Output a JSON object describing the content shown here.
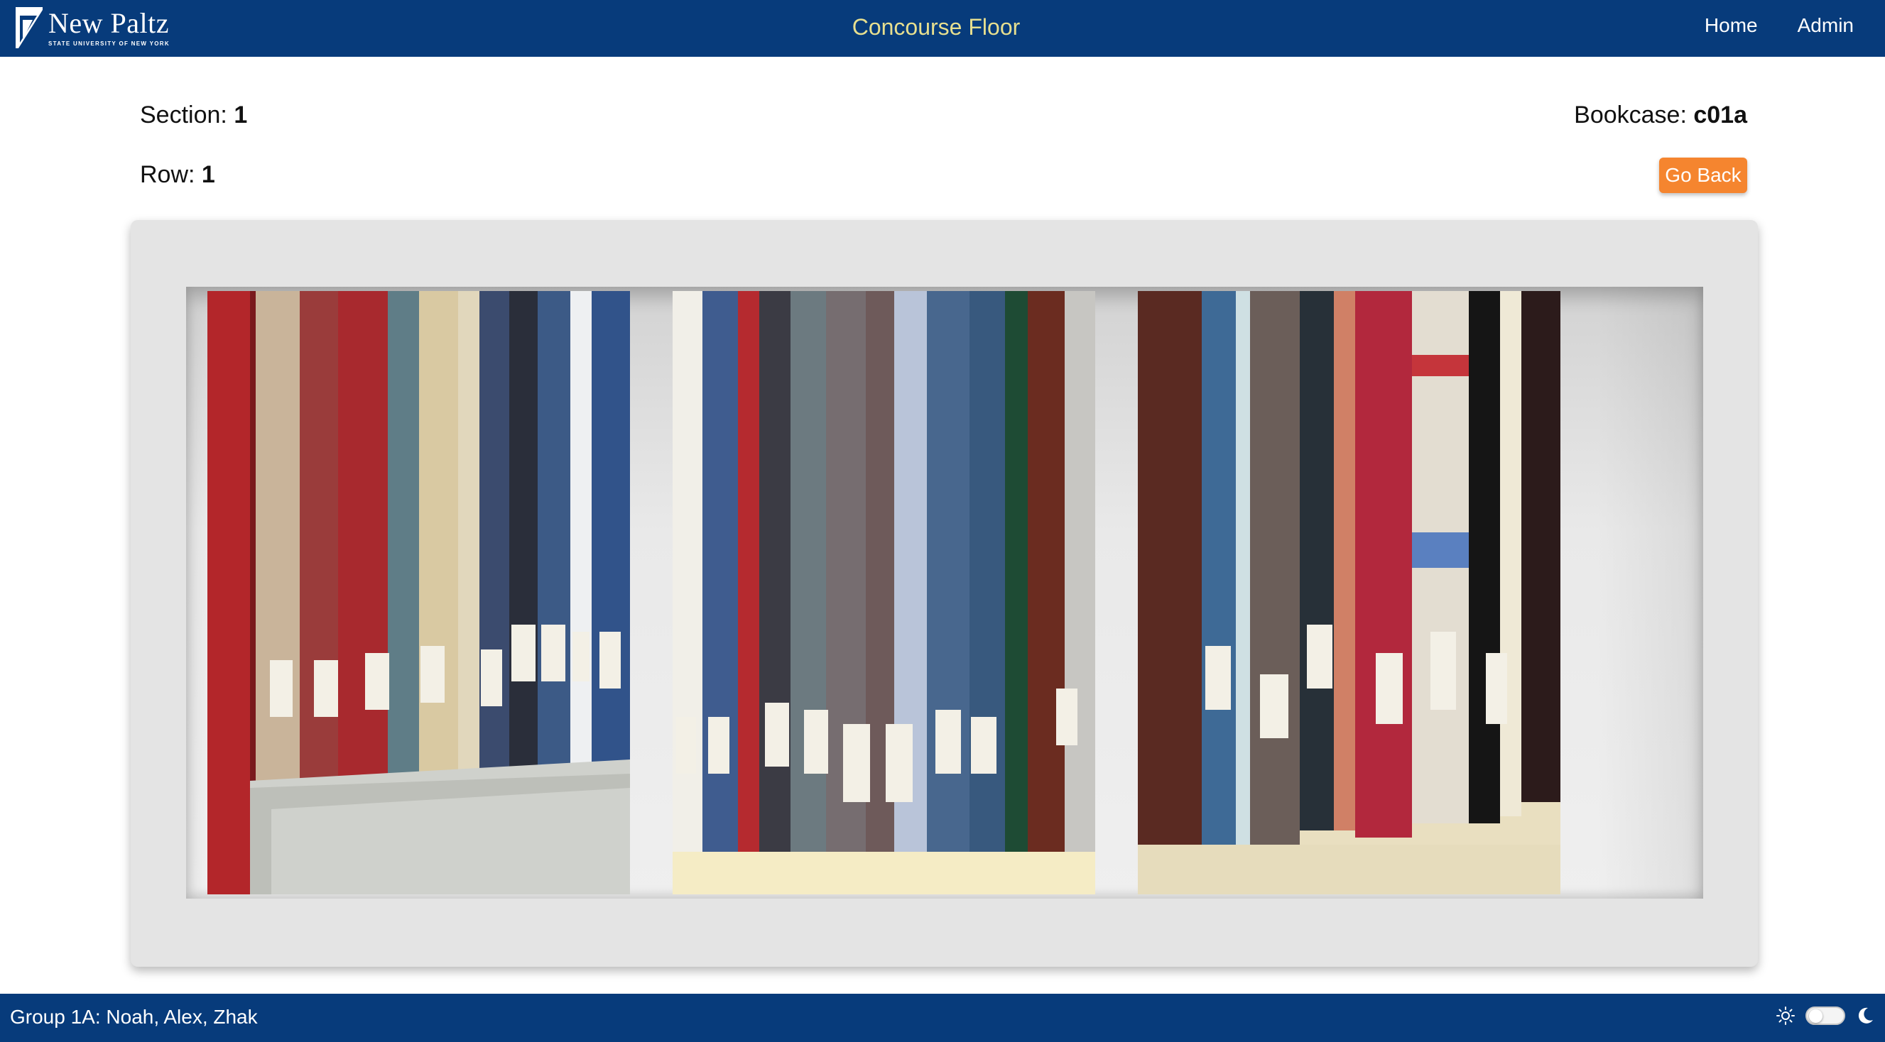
{
  "header": {
    "logo_name": "New Paltz",
    "logo_subtitle": "STATE UNIVERSITY OF NEW YORK",
    "title": "Concourse Floor",
    "nav": {
      "home": "Home",
      "admin": "Admin"
    }
  },
  "info": {
    "section_label": "Section: ",
    "section_value": "1",
    "row_label": "Row: ",
    "row_value": "1",
    "bookcase_label": "Bookcase: ",
    "bookcase_value": "c01a",
    "go_back_label": "Go Back"
  },
  "footer": {
    "credits": "Group 1A: Noah, Alex, Zhak",
    "icons": {
      "light": "sun-icon",
      "dark": "moon-icon"
    },
    "theme_mode": "light"
  },
  "colors": {
    "brand_blue": "#073b7b",
    "title_gold": "#e7df8f",
    "accent_orange": "#f5852f"
  }
}
